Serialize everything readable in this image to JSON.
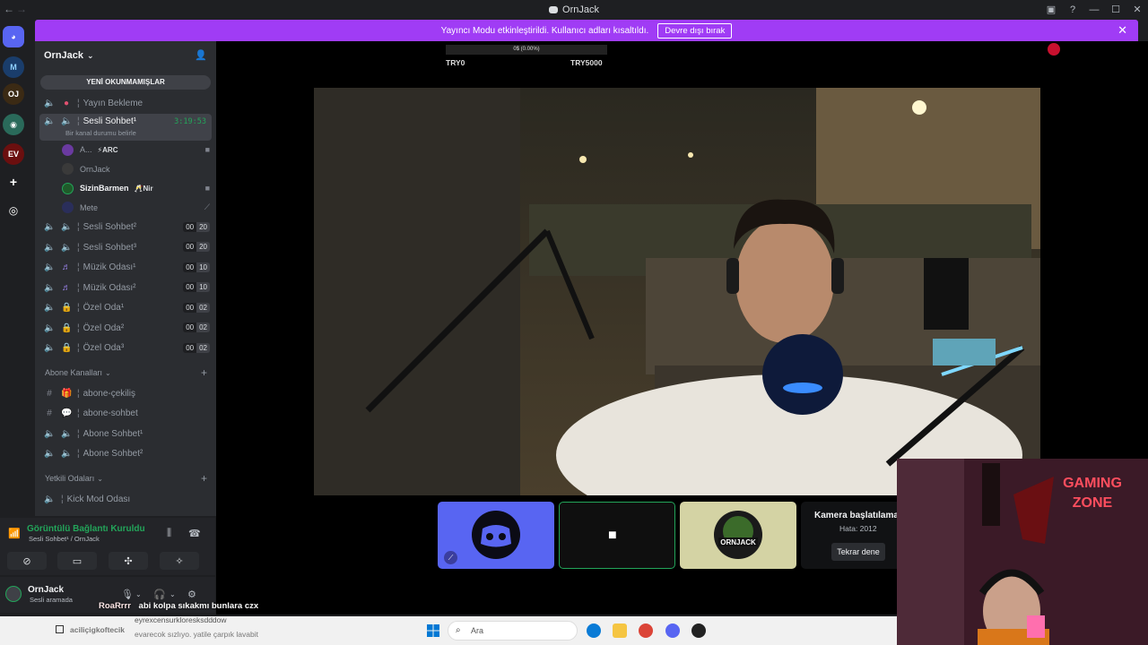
{
  "window": {
    "title": "OrnJack"
  },
  "banner": {
    "message": "Yayıncı Modu etkinleştirildi. Kullanıcı adları kısaltıldı.",
    "button": "Devre dışı bırak"
  },
  "server": {
    "name": "OrnJack",
    "unread_label": "YENİ OKUNMAMIŞLAR"
  },
  "channels": [
    {
      "label": "Yayın Bekleme",
      "count": "",
      "cap": ""
    },
    {
      "label": "Sesli Sohbet¹",
      "timer": "3:19:53",
      "status": "Bir kanal durumu belirle"
    },
    {
      "label": "Sesli Sohbet²",
      "count": "00",
      "cap": "20"
    },
    {
      "label": "Sesli Sohbet³",
      "count": "00",
      "cap": "20"
    },
    {
      "label": "Müzik Odası¹",
      "count": "00",
      "cap": "10"
    },
    {
      "label": "Müzik Odası²",
      "count": "00",
      "cap": "10"
    },
    {
      "label": "Özel Oda¹",
      "count": "00",
      "cap": "02"
    },
    {
      "label": "Özel Oda²",
      "count": "00",
      "cap": "02"
    },
    {
      "label": "Özel Oda³",
      "count": "00",
      "cap": "02"
    }
  ],
  "voice_users": [
    {
      "name": "A...",
      "tag": "⚡ARC"
    },
    {
      "name": "OrnJack",
      "tag": ""
    },
    {
      "name": "SizinBarmen",
      "tag": "🥂Nir"
    },
    {
      "name": "Mete",
      "tag": ""
    }
  ],
  "categories": [
    {
      "name": "Abone Kanalları",
      "items": [
        "abone-çekiliş",
        "abone-sohbet",
        "Abone Sohbet¹",
        "Abone Sohbet²"
      ]
    },
    {
      "name": "Yetkili Odaları",
      "items": [
        "Kick Mod Odası"
      ]
    }
  ],
  "voice_panel": {
    "status": "Görüntülü Bağlantı Kuruldu",
    "sub": "Sesli Sohbet¹ / OrnJack"
  },
  "user_panel": {
    "name": "OrnJack",
    "sub": "Sesli aramada"
  },
  "overlay": {
    "progress_text": "0$ (0.00%)",
    "left_label": "TRY0",
    "right_label": "TRY5000"
  },
  "tiles": {
    "camera_error_title": "Kamera başlatılama",
    "camera_error_code": "Hata: 2012",
    "retry_button": "Tekrar dene"
  },
  "chat": {
    "user": "RoaRrrr",
    "message": "abi kolpa sıkakmı bunlara czx",
    "faded_1": "eyrexcensurkloresksdddow",
    "faded_user": "aciliçigkoftecik",
    "faded_2": "evarecok sızlıyo. yatile çarpık lavabit"
  },
  "taskbar": {
    "search_placeholder": "Ara"
  },
  "colors": {
    "accent": "#a03cf5",
    "blurple": "#5865f2",
    "online": "#23a55a",
    "sidebar": "#2b2d31"
  }
}
